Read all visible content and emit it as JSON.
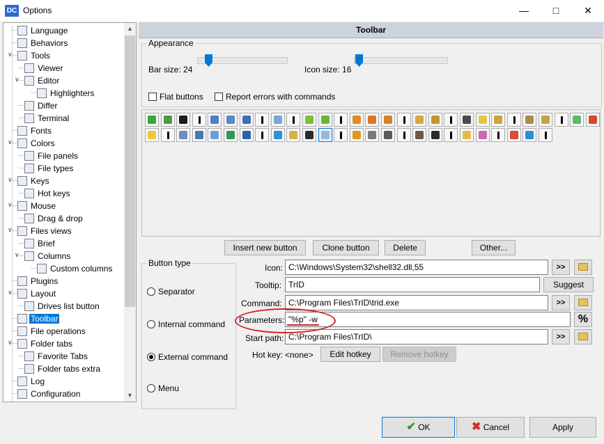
{
  "window": {
    "title": "Options",
    "app_icon": "DC"
  },
  "sidebar": {
    "items": [
      {
        "label": "Language",
        "icon": "language-icon",
        "level": 1
      },
      {
        "label": "Behaviors",
        "icon": "behaviors-icon",
        "level": 1
      },
      {
        "label": "Tools",
        "icon": "tools-icon",
        "level": 1
      },
      {
        "label": "Viewer",
        "icon": "viewer-icon",
        "level": 2
      },
      {
        "label": "Editor",
        "icon": "editor-icon",
        "level": 2
      },
      {
        "label": "Highlighters",
        "icon": "highlighters-icon",
        "level": 3
      },
      {
        "label": "Differ",
        "icon": "differ-icon",
        "level": 2
      },
      {
        "label": "Terminal",
        "icon": "terminal-icon",
        "level": 2
      },
      {
        "label": "Fonts",
        "icon": "fonts-icon",
        "level": 1
      },
      {
        "label": "Colors",
        "icon": "colors-icon",
        "level": 1
      },
      {
        "label": "File panels",
        "icon": "file-panels-icon",
        "level": 2
      },
      {
        "label": "File types",
        "icon": "file-types-icon",
        "level": 2
      },
      {
        "label": "Keys",
        "icon": "keys-icon",
        "level": 1
      },
      {
        "label": "Hot keys",
        "icon": "hot-keys-icon",
        "level": 2
      },
      {
        "label": "Mouse",
        "icon": "mouse-icon",
        "level": 1
      },
      {
        "label": "Drag & drop",
        "icon": "drag-drop-icon",
        "level": 2
      },
      {
        "label": "Files views",
        "icon": "files-views-icon",
        "level": 1
      },
      {
        "label": "Brief",
        "icon": "brief-icon",
        "level": 2
      },
      {
        "label": "Columns",
        "icon": "columns-icon",
        "level": 2
      },
      {
        "label": "Custom columns",
        "icon": "custom-columns-icon",
        "level": 3
      },
      {
        "label": "Plugins",
        "icon": "plugins-icon",
        "level": 1
      },
      {
        "label": "Layout",
        "icon": "layout-icon",
        "level": 1
      },
      {
        "label": "Drives list button",
        "icon": "drives-list-icon",
        "level": 2
      },
      {
        "label": "Toolbar",
        "icon": "toolbar-icon",
        "level": 1,
        "selected": true
      },
      {
        "label": "File operations",
        "icon": "file-operations-icon",
        "level": 1
      },
      {
        "label": "Folder tabs",
        "icon": "folder-tabs-icon",
        "level": 1
      },
      {
        "label": "Favorite Tabs",
        "icon": "favorite-tabs-icon",
        "level": 2
      },
      {
        "label": "Folder tabs extra",
        "icon": "folder-tabs-extra-icon",
        "level": 2
      },
      {
        "label": "Log",
        "icon": "log-icon",
        "level": 1
      },
      {
        "label": "Configuration",
        "icon": "configuration-icon",
        "level": 1
      }
    ]
  },
  "panel": {
    "header": "Toolbar",
    "appearance": {
      "title": "Appearance",
      "bar_size_label": "Bar size: 24",
      "icon_size_label": "Icon size: 16",
      "bar_size_fraction": 0.05,
      "icon_size_fraction": 0.0,
      "flat_buttons_label": "Flat buttons",
      "flat_buttons_checked": false,
      "report_errors_label": "Report errors with commands",
      "report_errors_checked": false
    },
    "toolbar_rows": [
      [
        "green-refresh",
        "green-arrow-left",
        "terminal",
        "sep",
        "columns-view",
        "brief-view",
        "thumbnails-view",
        "sep",
        "tree",
        "sep",
        "copy-left",
        "copy-right",
        "sep",
        "paw-1",
        "paw-2",
        "paw-3",
        "sep",
        "box-1",
        "box-2",
        "sep",
        "binoculars",
        "edit",
        "pack",
        "sep",
        "clipboard",
        "archive",
        "sep",
        "note",
        "delete-x"
      ],
      [
        "pdf",
        "sep",
        "touch",
        "save-sync",
        "window",
        "arrows",
        "blue-arrow",
        "sep",
        "windows-logo",
        "folder-open",
        "explorer-hd",
        "file",
        "sep",
        "audacity",
        "gallery",
        "sound",
        "sep",
        "gimp",
        "inkscape",
        "sep",
        "wave",
        "palette",
        "sep",
        "chrome",
        "ie",
        "sep"
      ]
    ],
    "toolbar_colors": {
      "green-refresh": "#3aa93a",
      "green-arrow-left": "#4a9a4a",
      "terminal": "#1c1c1c",
      "columns-view": "#4f7fc4",
      "brief-view": "#5a88c8",
      "thumbnails-view": "#3f6fb5",
      "tree": "#7aa7d8",
      "copy-left": "#7bbf3c",
      "copy-right": "#6fb533",
      "paw-1": "#e08a2a",
      "paw-2": "#e0742a",
      "paw-3": "#d9822e",
      "box-1": "#d9a441",
      "box-2": "#c69333",
      "binoculars": "#4b4b4b",
      "edit": "#e8c447",
      "pack": "#cfa53a",
      "clipboard": "#a98b4a",
      "archive": "#c7a24a",
      "note": "#5fb86f",
      "delete-x": "#d44a2a",
      "pdf": "#e5cc3a",
      "touch": "#6a8ec0",
      "save-sync": "#4a78b0",
      "window": "#6aa0d8",
      "arrows": "#2f9a4f",
      "blue-arrow": "#2a5fb0",
      "windows-logo": "#2f8fd6",
      "folder-open": "#d6b14a",
      "explorer-hd": "#2a2a2a",
      "file": "#9ab6d8",
      "audacity": "#e09a1a",
      "gallery": "#7a7a7a",
      "sound": "#5a5a5a",
      "gimp": "#6a5a4a",
      "inkscape": "#2a2a2a",
      "wave": "#e8b84a",
      "palette": "#c86ab0",
      "chrome": "#d94a3a",
      "ie": "#2a8fd6"
    },
    "active_button": "file",
    "buttons": {
      "insert_new": "Insert new button",
      "clone": "Clone button",
      "delete": "Delete",
      "other": "Other..."
    },
    "button_type": {
      "title": "Button type",
      "options": [
        "Separator",
        "Internal command",
        "External command",
        "Menu"
      ],
      "selected": "External command"
    },
    "form": {
      "icon_label": "Icon:",
      "icon_value": "C:\\Windows\\System32\\shell32.dll,55",
      "tooltip_label": "Tooltip:",
      "tooltip_value": "TrID",
      "suggest_label": "Suggest",
      "command_label": "Command:",
      "command_value": "C:\\Program Files\\TrID\\trid.exe",
      "parameters_label": "Parameters:",
      "parameters_value": "\"%p\" -w",
      "percent_label": "%",
      "start_path_label": "Start path:",
      "start_path_value": "C:\\Program Files\\TrID\\",
      "hotkey_label": "Hot key:",
      "hotkey_value": "<none>",
      "edit_hotkey_label": "Edit hotkey",
      "remove_hotkey_label": "Remove hotkey",
      "browse_label": ">>"
    }
  },
  "footer": {
    "ok_label": "OK",
    "cancel_label": "Cancel",
    "apply_label": "Apply"
  }
}
